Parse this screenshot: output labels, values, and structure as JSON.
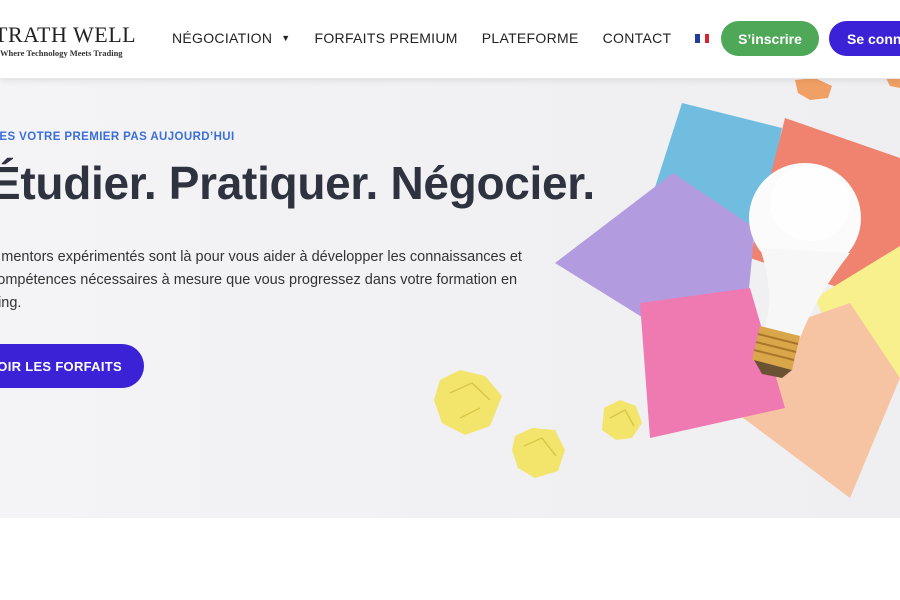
{
  "brand": {
    "name": "TRATH WELL",
    "tagline": "Where Technology Meets Trading"
  },
  "nav": {
    "items": [
      {
        "label": "NÉGOCIATION",
        "has_dropdown": true
      },
      {
        "label": "FORFAITS PREMIUM",
        "has_dropdown": false
      },
      {
        "label": "PLATEFORME",
        "has_dropdown": false
      },
      {
        "label": "CONTACT",
        "has_dropdown": false
      }
    ],
    "language_flag": "french-flag-icon"
  },
  "header_buttons": {
    "register": "S’inscrire",
    "login": "Se conne"
  },
  "hero": {
    "eyebrow": "TES VOTRE PREMIER PAS AUJOURD’HUI",
    "headline": "Étudier. Pratiquer. Négocier.",
    "description_lines": [
      "s mentors expérimentés sont là pour vous aider à développer les connaissances et",
      "compétences nécessaires à mesure que vous progressez dans votre formation en",
      "ding."
    ],
    "cta": "VOIR LES FORFAITS"
  },
  "colors": {
    "brand_green": "#4ea858",
    "brand_purple": "#3b22d6",
    "eyebrow_blue": "#3b6fd8",
    "headline": "#2f3340"
  }
}
